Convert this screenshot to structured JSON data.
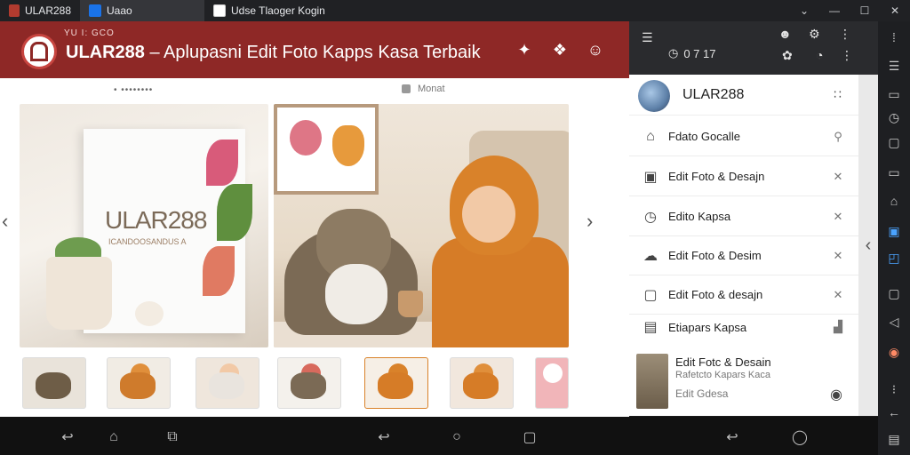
{
  "tabs": [
    {
      "label": "ULAR288",
      "icon": "red-app-icon",
      "color": "#b23b2f"
    },
    {
      "label": "Uaao",
      "icon": "photo-icon",
      "color": "#1a73e8"
    },
    {
      "label": "Udse Tlaoger Kogin",
      "icon": "doc-icon",
      "color": "#ffffff"
    }
  ],
  "window_controls": {
    "chevron": "⌄",
    "minimize": "—",
    "maximize": "☐",
    "close": "✕"
  },
  "banner": {
    "small": "YU  I:  GCO",
    "title_bold": "ULAR288",
    "title_rest": " – Aplupasni Edit Foto Kapps Kasa Terbaik",
    "bg": "#8e2826"
  },
  "subbar": {
    "dots": "• ••••••••",
    "label": "Monat"
  },
  "hero_left": {
    "board_text": "ULAR288",
    "board_sub": "ICANDOOSANDUS A"
  },
  "right_panel": {
    "time": "0 7 17",
    "profile_name": "ULAR288",
    "menu_items": [
      {
        "icon": "folder-icon",
        "label": "Fdato Gocalle",
        "trailing": "user-icon"
      },
      {
        "icon": "image-icon",
        "label": "Edit Foto & Desajn",
        "trailing": "pin-icon"
      },
      {
        "icon": "clock-icon",
        "label": "Edito Kapsa",
        "trailing": "pin-icon"
      },
      {
        "icon": "cloud-icon",
        "label": "Edit Foto & Desim",
        "trailing": "pin-icon"
      },
      {
        "icon": "file-icon",
        "label": "Edit Foto & desajn",
        "trailing": "pin-icon"
      },
      {
        "icon": "doc-icon",
        "label": "Etiapars Kapsa",
        "trailing": "chart-icon"
      }
    ],
    "card": {
      "title": "Edit Fotc & Desain",
      "subtitle": "Rafetcto Kapars Kaca",
      "meta": "Edit Gdesa"
    }
  }
}
